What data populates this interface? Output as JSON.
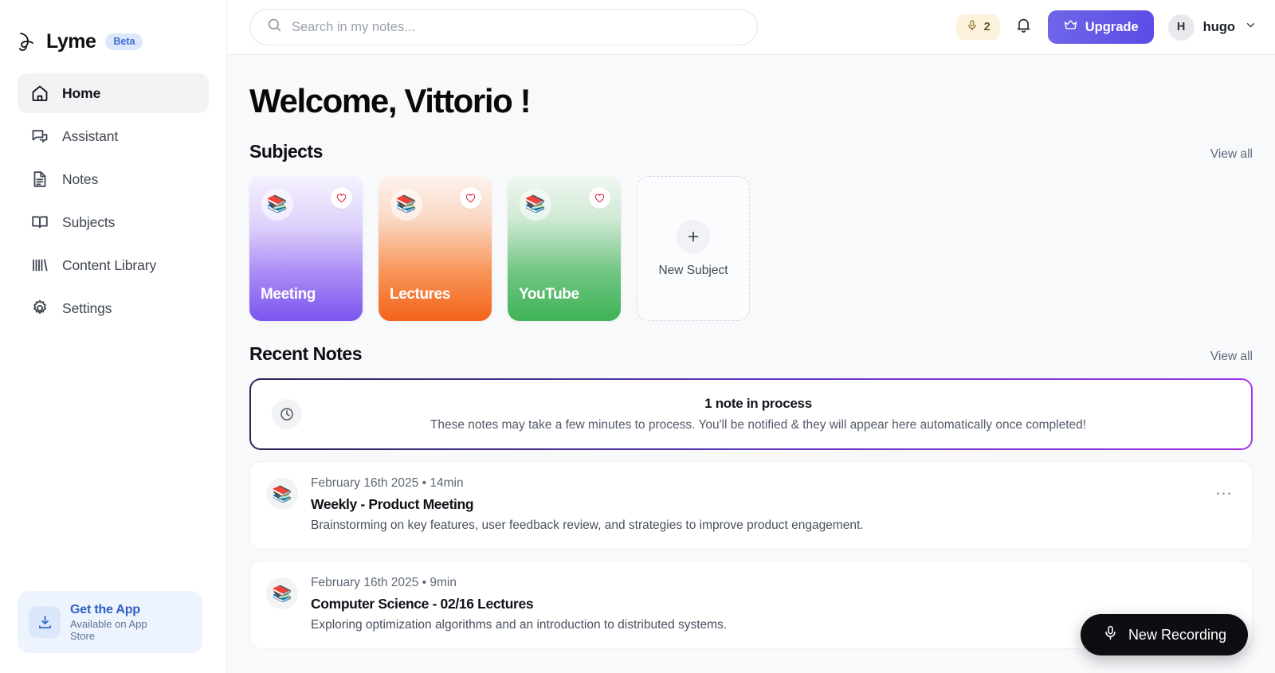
{
  "sidebar": {
    "brand": {
      "name": "Lyme",
      "badge": "Beta",
      "logo_icon": "lyme-logo-icon"
    },
    "items": [
      {
        "label": "Home",
        "icon": "home-icon",
        "active": true
      },
      {
        "label": "Assistant",
        "icon": "chat-bubbles-icon",
        "active": false
      },
      {
        "label": "Notes",
        "icon": "document-icon",
        "active": false
      },
      {
        "label": "Subjects",
        "icon": "book-open-icon",
        "active": false
      },
      {
        "label": "Content Library",
        "icon": "library-bars-icon",
        "active": false
      },
      {
        "label": "Settings",
        "icon": "gear-icon",
        "active": false
      }
    ],
    "get_app": {
      "title": "Get the App",
      "subtitle": "Available on App Store",
      "icon": "download-icon"
    }
  },
  "topbar": {
    "search": {
      "placeholder": "Search in my notes...",
      "value": "",
      "icon": "search-icon"
    },
    "credits": {
      "count": "2",
      "icon": "microphone-icon"
    },
    "notifications_icon": "bell-icon",
    "upgrade": {
      "label": "Upgrade",
      "icon": "crown-icon"
    },
    "profile": {
      "initial": "H",
      "name": "hugo",
      "chevron_icon": "chevron-down-icon"
    }
  },
  "main": {
    "welcome": "Welcome, Vittorio !",
    "subjects_section": {
      "title": "Subjects",
      "view_all": "View all",
      "cards": [
        {
          "name": "Meeting",
          "emoji": "📚",
          "fav_icon": "heart-icon",
          "color_top": "#f3effd",
          "color_bottom": "#7b55f0"
        },
        {
          "name": "Lectures",
          "emoji": "📚",
          "fav_icon": "heart-icon",
          "color_top": "#fdf1ea",
          "color_bottom": "#f4641b"
        },
        {
          "name": "YouTube",
          "emoji": "📚",
          "fav_icon": "heart-icon",
          "color_top": "#eef7ef",
          "color_bottom": "#3fb357"
        }
      ],
      "new_subject": {
        "label": "New Subject",
        "icon": "plus-icon"
      }
    },
    "recent_section": {
      "title": "Recent Notes",
      "view_all": "View all",
      "processing_banner": {
        "title": "1 note in process",
        "subtitle": "These notes may take a few minutes to process. You'll be notified & they will appear here automatically once completed!",
        "icon": "clock-icon",
        "border_gradient_start": "#2c2455",
        "border_gradient_end": "#a436e8"
      },
      "notes": [
        {
          "date": "February 16th 2025",
          "duration": "14min",
          "title": "Weekly - Product Meeting",
          "description": "Brainstorming on key features, user feedback review, and strategies to improve product engagement.",
          "emoji": "📚",
          "more_icon": "ellipsis-icon"
        },
        {
          "date": "February 16th 2025",
          "duration": "9min",
          "title": "Computer Science - 02/16 Lectures",
          "description": "Exploring optimization algorithms and an introduction to distributed systems.",
          "emoji": "📚",
          "more_icon": "ellipsis-icon"
        }
      ]
    },
    "fab": {
      "label": "New Recording",
      "icon": "microphone-icon"
    }
  },
  "separator": "•"
}
